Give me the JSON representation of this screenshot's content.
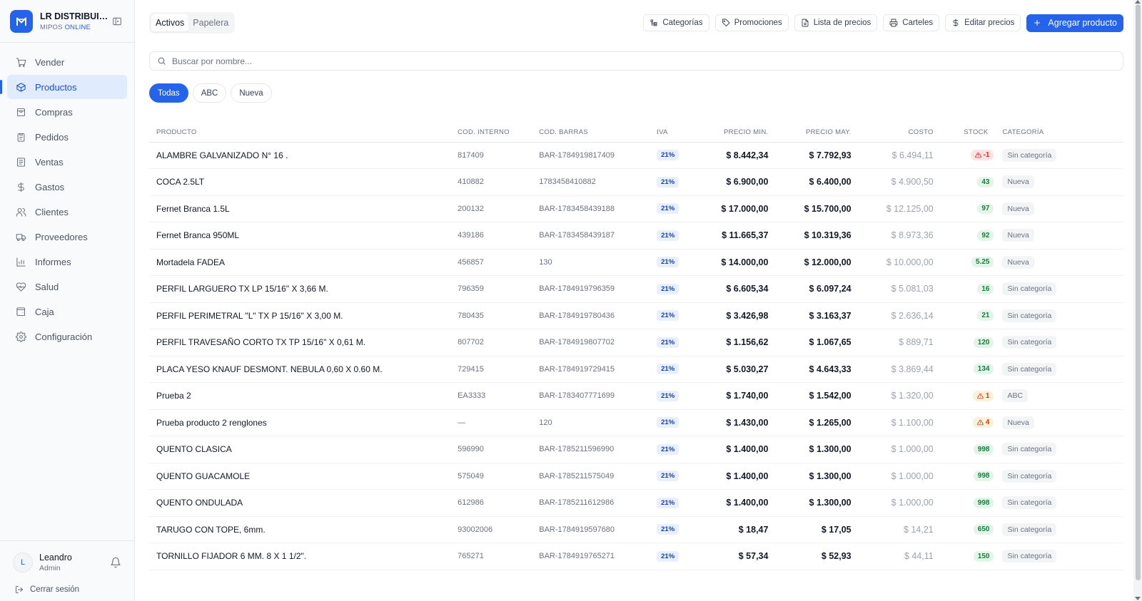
{
  "brand": {
    "name": "LR DISTRIBUID...",
    "sub_prefix": "MIPOS",
    "sub_online": "ONLINE"
  },
  "nav": [
    {
      "label": "Vender",
      "icon": "cart-icon",
      "active": false
    },
    {
      "label": "Productos",
      "icon": "box-icon",
      "active": true
    },
    {
      "label": "Compras",
      "icon": "bag-icon",
      "active": false
    },
    {
      "label": "Pedidos",
      "icon": "clipboard-icon",
      "active": false
    },
    {
      "label": "Ventas",
      "icon": "receipt-icon",
      "active": false
    },
    {
      "label": "Gastos",
      "icon": "dollar-icon",
      "active": false
    },
    {
      "label": "Clientes",
      "icon": "users-icon",
      "active": false
    },
    {
      "label": "Proveedores",
      "icon": "truck-icon",
      "active": false
    },
    {
      "label": "Informes",
      "icon": "bar-chart-icon",
      "active": false
    },
    {
      "label": "Salud",
      "icon": "heart-pulse-icon",
      "active": false
    },
    {
      "label": "Caja",
      "icon": "wallet-icon",
      "active": false
    },
    {
      "label": "Configuración",
      "icon": "gear-icon",
      "active": false
    }
  ],
  "user": {
    "initial": "L",
    "name": "Leandro",
    "role": "Admin",
    "logout": "Cerrar sesión"
  },
  "tabs": {
    "active": "Activos",
    "trash": "Papelera"
  },
  "actions": {
    "categorias": "Categorías",
    "promociones": "Promociones",
    "lista_precios": "Lista de precios",
    "carteles": "Carteles",
    "editar_precios": "Editar precios",
    "agregar": "Agregar producto"
  },
  "search": {
    "placeholder": "Buscar por nombre..."
  },
  "filters": {
    "all": "Todas",
    "abc": "ABC",
    "nueva": "Nueva"
  },
  "columns": {
    "producto": "PRODUCTO",
    "cod_interno": "COD. INTERNO",
    "cod_barras": "COD. BARRAS",
    "iva": "IVA",
    "precio_min": "PRECIO MIN.",
    "precio_may": "PRECIO MAY.",
    "costo": "COSTO",
    "stock": "STOCK",
    "categoria": "CATEGORÍA"
  },
  "colors": {
    "accent": "#2563eb",
    "stock_ok": "#15803d",
    "stock_low": "#c2410c",
    "stock_neg": "#dc2626"
  },
  "products": [
    {
      "name": "ALAMBRE GALVANIZADO N° 16 .",
      "cod_interno": "817409",
      "cod_barras": "BAR-1784919817409",
      "iva": "21%",
      "precio_min": "$ 8.442,34",
      "precio_may": "$ 7.792,93",
      "costo": "$ 6.494,11",
      "stock": "-1",
      "stock_status": "red",
      "categoria": "Sin categoría"
    },
    {
      "name": "COCA 2.5LT",
      "cod_interno": "410882",
      "cod_barras": "1783458410882",
      "iva": "21%",
      "precio_min": "$ 6.900,00",
      "precio_may": "$ 6.400,00",
      "costo": "$ 4.900,50",
      "stock": "43",
      "stock_status": "green",
      "categoria": "Nueva"
    },
    {
      "name": "Fernet Branca 1.5L",
      "cod_interno": "200132",
      "cod_barras": "BAR-1783458439188",
      "iva": "21%",
      "precio_min": "$ 17.000,00",
      "precio_may": "$ 15.700,00",
      "costo": "$ 12.125,00",
      "stock": "97",
      "stock_status": "green",
      "categoria": "Nueva"
    },
    {
      "name": "Fernet Branca 950ML",
      "cod_interno": "439186",
      "cod_barras": "BAR-1783458439187",
      "iva": "21%",
      "precio_min": "$ 11.665,37",
      "precio_may": "$ 10.319,36",
      "costo": "$ 8.973,36",
      "stock": "92",
      "stock_status": "green",
      "categoria": "Nueva"
    },
    {
      "name": "Mortadela FADEA",
      "cod_interno": "456857",
      "cod_barras": "130",
      "iva": "21%",
      "precio_min": "$ 14.000,00",
      "precio_may": "$ 12.000,00",
      "costo": "$ 10.000,00",
      "stock": "5.25",
      "stock_status": "green",
      "categoria": "Nueva"
    },
    {
      "name": "PERFIL LARGUERO TX LP 15/16\" X 3,66 M.",
      "cod_interno": "796359",
      "cod_barras": "BAR-1784919796359",
      "iva": "21%",
      "precio_min": "$ 6.605,34",
      "precio_may": "$ 6.097,24",
      "costo": "$ 5.081,03",
      "stock": "16",
      "stock_status": "green",
      "categoria": "Sin categoría"
    },
    {
      "name": "PERFIL PERIMETRAL \"L\" TX P 15/16\" X 3,00 M.",
      "cod_interno": "780435",
      "cod_barras": "BAR-1784919780436",
      "iva": "21%",
      "precio_min": "$ 3.426,98",
      "precio_may": "$ 3.163,37",
      "costo": "$ 2.636,14",
      "stock": "21",
      "stock_status": "green",
      "categoria": "Sin categoría"
    },
    {
      "name": "PERFIL TRAVESAÑO CORTO TX TP 15/16\" X 0,61 M.",
      "cod_interno": "807702",
      "cod_barras": "BAR-1784919807702",
      "iva": "21%",
      "precio_min": "$ 1.156,62",
      "precio_may": "$ 1.067,65",
      "costo": "$ 889,71",
      "stock": "120",
      "stock_status": "green",
      "categoria": "Sin categoría"
    },
    {
      "name": "PLACA YESO KNAUF DESMONT. NEBULA 0,60 X 0.60 M.",
      "cod_interno": "729415",
      "cod_barras": "BAR-1784919729415",
      "iva": "21%",
      "precio_min": "$ 5.030,27",
      "precio_may": "$ 4.643,33",
      "costo": "$ 3.869,44",
      "stock": "134",
      "stock_status": "green",
      "categoria": "Sin categoría"
    },
    {
      "name": "Prueba 2",
      "cod_interno": "EA3333",
      "cod_barras": "BAR-1783407771699",
      "iva": "21%",
      "precio_min": "$ 1.740,00",
      "precio_may": "$ 1.542,00",
      "costo": "$ 1.320,00",
      "stock": "1",
      "stock_status": "orange",
      "categoria": "ABC"
    },
    {
      "name": "Prueba producto 2 renglones",
      "cod_interno": "—",
      "cod_barras": "120",
      "iva": "21%",
      "precio_min": "$ 1.430,00",
      "precio_may": "$ 1.265,00",
      "costo": "$ 1.100,00",
      "stock": "4",
      "stock_status": "orange",
      "categoria": "Nueva"
    },
    {
      "name": "QUENTO CLASICA",
      "cod_interno": "596990",
      "cod_barras": "BAR-1785211596990",
      "iva": "21%",
      "precio_min": "$ 1.400,00",
      "precio_may": "$ 1.300,00",
      "costo": "$ 1.000,00",
      "stock": "998",
      "stock_status": "green",
      "categoria": "Sin categoría"
    },
    {
      "name": "QUENTO GUACAMOLE",
      "cod_interno": "575049",
      "cod_barras": "BAR-1785211575049",
      "iva": "21%",
      "precio_min": "$ 1.400,00",
      "precio_may": "$ 1.300,00",
      "costo": "$ 1.000,00",
      "stock": "998",
      "stock_status": "green",
      "categoria": "Sin categoría"
    },
    {
      "name": "QUENTO ONDULADA",
      "cod_interno": "612986",
      "cod_barras": "BAR-1785211612986",
      "iva": "21%",
      "precio_min": "$ 1.400,00",
      "precio_may": "$ 1.300,00",
      "costo": "$ 1.000,00",
      "stock": "998",
      "stock_status": "green",
      "categoria": "Sin categoría"
    },
    {
      "name": "TARUGO CON TOPE, 6mm.",
      "cod_interno": "93002006",
      "cod_barras": "BAR-1784919597680",
      "iva": "21%",
      "precio_min": "$ 18,47",
      "precio_may": "$ 17,05",
      "costo": "$ 14,21",
      "stock": "650",
      "stock_status": "green",
      "categoria": "Sin categoría"
    },
    {
      "name": "TORNILLO FIJADOR 6 MM. 8 X 1 1/2\".",
      "cod_interno": "765271",
      "cod_barras": "BAR-1784919765271",
      "iva": "21%",
      "precio_min": "$ 57,34",
      "precio_may": "$ 52,93",
      "costo": "$ 44,11",
      "stock": "150",
      "stock_status": "green",
      "categoria": "Sin categoría"
    }
  ]
}
